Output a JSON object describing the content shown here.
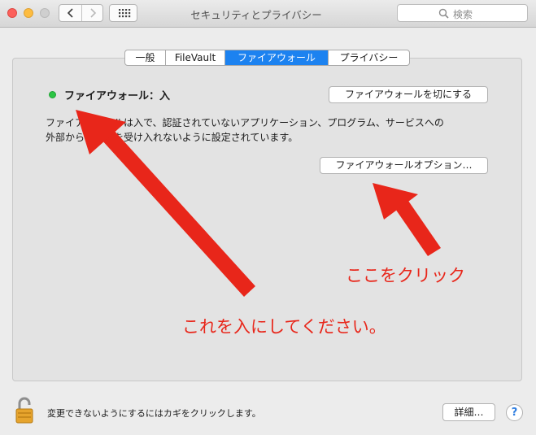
{
  "window": {
    "title": "セキュリティとプライバシー",
    "search_placeholder": "検索"
  },
  "tabs": [
    {
      "label": "一般",
      "active": false
    },
    {
      "label": "FileVault",
      "active": false
    },
    {
      "label": "ファイアウォール",
      "active": true
    },
    {
      "label": "プライバシー",
      "active": false
    }
  ],
  "firewall": {
    "status": "ファイアウォール：入",
    "status_color": "#2cc544",
    "turn_off_label": "ファイアウォールを切にする",
    "description_line1": "ファイアウォールは入で、認証されていないアプリケーション、プログラム、サービスへの",
    "description_line2": "外部からの接続を受け入れないように設定されています。",
    "options_label": "ファイアウォールオプション…"
  },
  "annotations": {
    "click_here": "ここをクリック",
    "enable_this": "これを入にしてください。",
    "color": "#e8261a"
  },
  "bottom": {
    "lock_text": "変更できないようにするにはカギをクリックします。",
    "advanced_label": "詳細…",
    "help_label": "?"
  }
}
